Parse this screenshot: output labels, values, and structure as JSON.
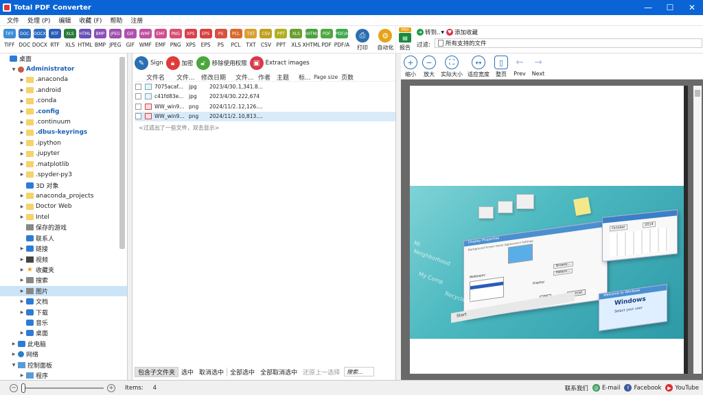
{
  "window": {
    "title": "Total PDF Converter"
  },
  "menu": [
    "文件",
    "处理 (P)",
    "编辑",
    "收藏 (F)",
    "帮助",
    "注册"
  ],
  "formats": [
    {
      "icon": "TIFF",
      "label": "TIFF",
      "color": "#3b8ed8"
    },
    {
      "icon": "DOC",
      "label": "DOC",
      "color": "#2f6fc4"
    },
    {
      "icon": "DOCX",
      "label": "DOCX",
      "color": "#2f6fc4"
    },
    {
      "icon": "RTF",
      "label": "RTF",
      "color": "#2a5cb8"
    },
    {
      "icon": "XLS",
      "label": "XLS",
      "color": "#2a7a3c"
    },
    {
      "icon": "HTML",
      "label": "HTML",
      "color": "#6a4fb8"
    },
    {
      "icon": "BMP",
      "label": "BMP",
      "color": "#8a4fb8"
    },
    {
      "icon": "JPEG",
      "label": "JPEG",
      "color": "#a04fb0"
    },
    {
      "icon": "GIF",
      "label": "GIF",
      "color": "#b04fb0"
    },
    {
      "icon": "WMF",
      "label": "WMF",
      "color": "#c04fa0"
    },
    {
      "icon": "EMF",
      "label": "EMF",
      "color": "#d04f90"
    },
    {
      "icon": "PNG",
      "label": "PNG",
      "color": "#d84f70"
    },
    {
      "icon": "XPS",
      "label": "XPS",
      "color": "#d8404a"
    },
    {
      "icon": "EPS",
      "label": "EPS",
      "color": "#d84040"
    },
    {
      "icon": "PS",
      "label": "PS",
      "color": "#d85040"
    },
    {
      "icon": "PCL",
      "label": "PCL",
      "color": "#d86a30"
    },
    {
      "icon": "TXT",
      "label": "TXT",
      "color": "#d8a030"
    },
    {
      "icon": "CSV",
      "label": "CSV",
      "color": "#c0a020"
    },
    {
      "icon": "PPT",
      "label": "PPT",
      "color": "#b0b020"
    },
    {
      "icon": "XLS",
      "label": "XLS",
      "color": "#6aa030"
    },
    {
      "icon": "XHTML",
      "label": "XHTML",
      "color": "#4aa040"
    },
    {
      "icon": "PDF",
      "label": "PDF",
      "color": "#50a840"
    },
    {
      "icon": "PDF/A",
      "label": "PDF/A",
      "color": "#40a850"
    }
  ],
  "toolbar": {
    "print": "打印",
    "automate": "自动化"
  },
  "right_toolbar": {
    "report": "报告",
    "report_badge": "PRO",
    "convert_to": "转到..",
    "favorites": "添加收藏",
    "filter_label": "过滤:",
    "filter_value": "所有支持的文件"
  },
  "tree": [
    {
      "label": "桌面",
      "indent": 0,
      "arrow": "",
      "icon": "blue"
    },
    {
      "label": "Administrator",
      "indent": 1,
      "arrow": "▼",
      "icon": "user",
      "style": "blue-bold"
    },
    {
      "label": ".anaconda",
      "indent": 2,
      "arrow": "▶",
      "icon": "folder"
    },
    {
      "label": ".android",
      "indent": 2,
      "arrow": "▶",
      "icon": "folder"
    },
    {
      "label": ".conda",
      "indent": 2,
      "arrow": "▶",
      "icon": "folder"
    },
    {
      "label": ".config",
      "indent": 2,
      "arrow": "▶",
      "icon": "folder",
      "style": "blue-bold"
    },
    {
      "label": ".continuum",
      "indent": 2,
      "arrow": "▶",
      "icon": "folder"
    },
    {
      "label": ".dbus-keyrings",
      "indent": 2,
      "arrow": "▶",
      "icon": "folder",
      "style": "blue-bold"
    },
    {
      "label": ".ipython",
      "indent": 2,
      "arrow": "▶",
      "icon": "folder"
    },
    {
      "label": ".jupyter",
      "indent": 2,
      "arrow": "▶",
      "icon": "folder"
    },
    {
      "label": ".matplotlib",
      "indent": 2,
      "arrow": "▶",
      "icon": "folder"
    },
    {
      "label": ".spyder-py3",
      "indent": 2,
      "arrow": "▶",
      "icon": "folder"
    },
    {
      "label": "3D 对象",
      "indent": 2,
      "arrow": "",
      "icon": "blue"
    },
    {
      "label": "anaconda_projects",
      "indent": 2,
      "arrow": "▶",
      "icon": "folder"
    },
    {
      "label": "Doctor Web",
      "indent": 2,
      "arrow": "▶",
      "icon": "folder"
    },
    {
      "label": "Intel",
      "indent": 2,
      "arrow": "▶",
      "icon": "folder"
    },
    {
      "label": "保存的游戏",
      "indent": 2,
      "arrow": "",
      "icon": "gray"
    },
    {
      "label": "联系人",
      "indent": 2,
      "arrow": "",
      "icon": "blue"
    },
    {
      "label": "链接",
      "indent": 2,
      "arrow": "▶",
      "icon": "blue"
    },
    {
      "label": "视频",
      "indent": 2,
      "arrow": "▶",
      "icon": "dark"
    },
    {
      "label": "收藏夹",
      "indent": 2,
      "arrow": "▶",
      "icon": "star"
    },
    {
      "label": "搜索",
      "indent": 2,
      "arrow": "▶",
      "icon": "gray"
    },
    {
      "label": "图片",
      "indent": 2,
      "arrow": "▶",
      "icon": "gray",
      "selected": true
    },
    {
      "label": "文档",
      "indent": 2,
      "arrow": "▶",
      "icon": "blue"
    },
    {
      "label": "下载",
      "indent": 2,
      "arrow": "▶",
      "icon": "blue"
    },
    {
      "label": "音乐",
      "indent": 2,
      "arrow": "",
      "icon": "blue"
    },
    {
      "label": "桌面",
      "indent": 2,
      "arrow": "▶",
      "icon": "blue"
    },
    {
      "label": "此电脑",
      "indent": 1,
      "arrow": "▶",
      "icon": "blue"
    },
    {
      "label": "网络",
      "indent": 1,
      "arrow": "▶",
      "icon": "globe"
    },
    {
      "label": "控制面板",
      "indent": 1,
      "arrow": "▼",
      "icon": "ctrl"
    },
    {
      "label": "程序",
      "indent": 2,
      "arrow": "▶",
      "icon": "ctrl"
    }
  ],
  "mid_toolbar": {
    "sign": "Sign",
    "encrypt": "加密",
    "remove_perm": "移除使用权限",
    "extract": "Extract images"
  },
  "columns": [
    "文件名",
    "文件...",
    "修改日期",
    "文件...",
    "作者",
    "主题",
    "标...",
    "Page size",
    "页数"
  ],
  "files": [
    {
      "name": "7075acaf...",
      "type": "jpg",
      "date": "2023/4/30...",
      "size": "1,341.8...",
      "icon": "jpg",
      "selected": false
    },
    {
      "name": "c41fd83e...",
      "type": "jpg",
      "date": "2023/4/30...",
      "size": "222,674",
      "icon": "jpg",
      "selected": false
    },
    {
      "name": "WW_win9...",
      "type": "png",
      "date": "2024/11/2...",
      "size": "12,126....",
      "icon": "png",
      "selected": false
    },
    {
      "name": "WW_win9...",
      "type": "png",
      "date": "2024/11/2...",
      "size": "10,813....",
      "icon": "png",
      "selected": true
    }
  ],
  "hint": "<过滤出了一些文件，双击显示>",
  "mid_bottom": {
    "include_subfolders": "包含子文件夹",
    "check": "选中",
    "uncheck": "取消选中",
    "check_all": "全部选中",
    "uncheck_all": "全部取消选中",
    "restore": "还原上一选择",
    "search": "搜索..."
  },
  "preview_toolbar": {
    "zoom_in": "缩小",
    "zoom_out": "放大",
    "actual": "实际大小",
    "fit_width": "适应宽度",
    "whole_page": "整页",
    "prev": "Prev",
    "next": "Next"
  },
  "preview_art": {
    "dialog_label": "Display Properties",
    "tabs": "Background   Screen Saver   Appearance   Settings",
    "wallpaper": "Wallpaper:",
    "browse": "Browse...",
    "pattern": "Pattern...",
    "display": "Display:",
    "ok": "OK",
    "cancel": "Cancel",
    "calendar_month": "October",
    "calendar_year": "2014",
    "desk_text1": "Mi",
    "desk_text2": "Neighborhood",
    "desk_text3": "My Comp",
    "desk_text4": "Recycle Bin",
    "desk_text5": "Start",
    "welcome": "Welcome to Windows",
    "windows": "Windows",
    "select_user": "Select your user"
  },
  "status": {
    "items_label": "Items:",
    "items_count": "4",
    "contact": "联系我们",
    "email": "E-mail",
    "facebook": "Facebook",
    "youtube": "YouTube"
  },
  "colors": {
    "titlebar": "#0a64d6",
    "selection": "#cce4f7",
    "accent_red": "#e03045"
  }
}
